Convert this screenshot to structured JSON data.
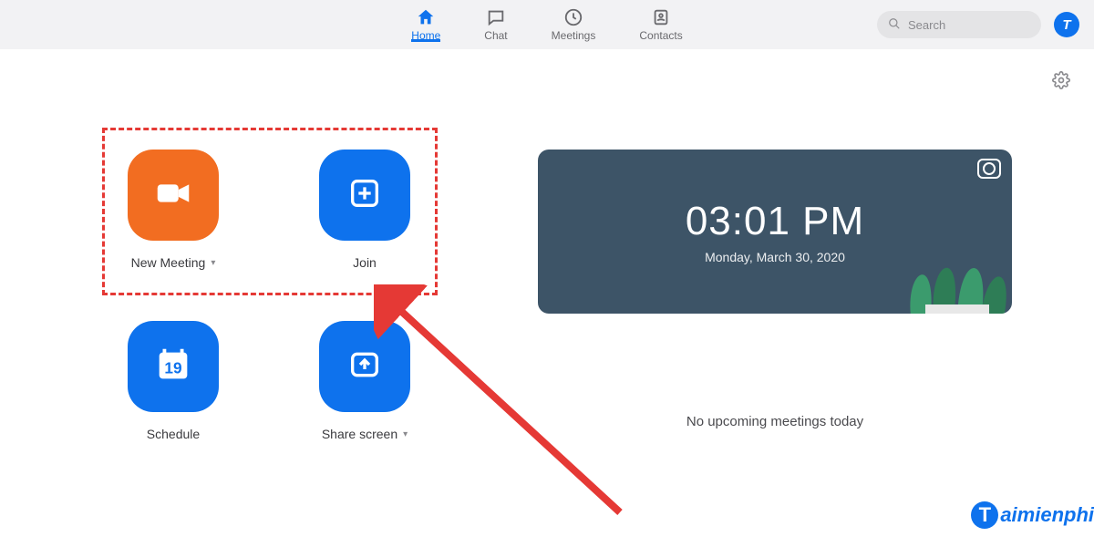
{
  "nav": {
    "tabs": {
      "home": "Home",
      "chat": "Chat",
      "meetings": "Meetings",
      "contacts": "Contacts"
    },
    "search_placeholder": "Search",
    "avatar_initial": "T"
  },
  "actions": {
    "new_meeting": "New Meeting",
    "join": "Join",
    "schedule": "Schedule",
    "schedule_day": "19",
    "share_screen": "Share screen"
  },
  "time_card": {
    "time": "03:01 PM",
    "date": "Monday, March 30, 2020"
  },
  "status": {
    "no_meetings": "No upcoming meetings today"
  },
  "watermark": {
    "letter": "T",
    "text": "aimienphi"
  },
  "colors": {
    "accent": "#0e72ed",
    "orange": "#f26d21",
    "highlight": "#e53935"
  }
}
